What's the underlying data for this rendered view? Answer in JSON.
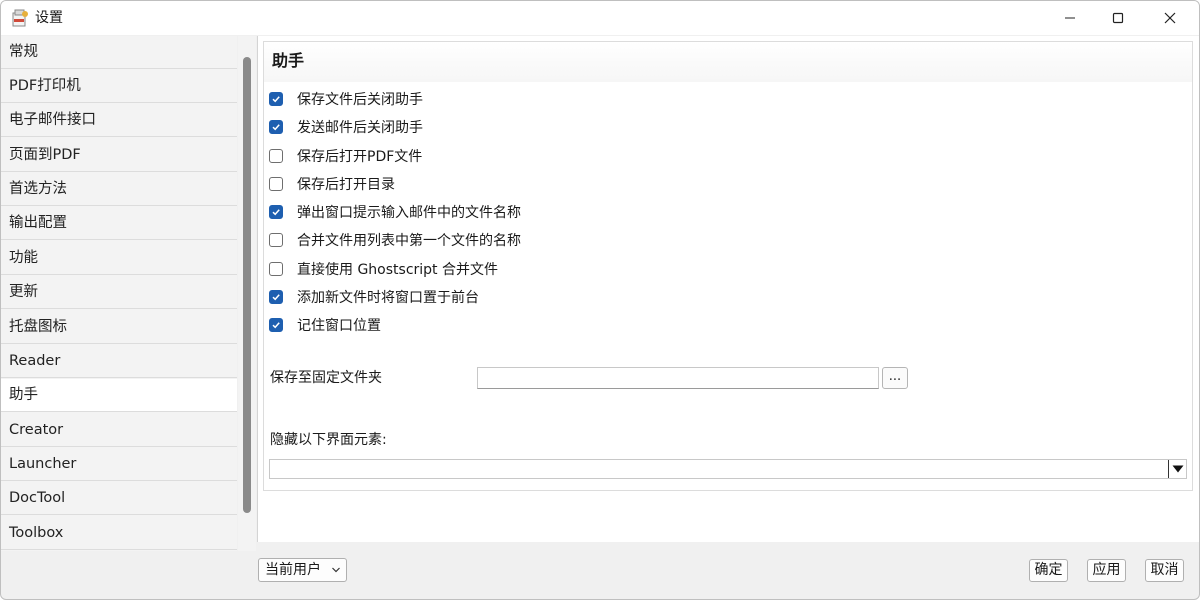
{
  "window": {
    "title": "设置"
  },
  "sidebar": {
    "items": [
      {
        "label": "常规"
      },
      {
        "label": "PDF打印机"
      },
      {
        "label": "电子邮件接口"
      },
      {
        "label": "页面到PDF"
      },
      {
        "label": "首选方法"
      },
      {
        "label": "输出配置"
      },
      {
        "label": "功能"
      },
      {
        "label": "更新"
      },
      {
        "label": "托盘图标"
      },
      {
        "label": "Reader"
      },
      {
        "label": "助手",
        "selected": true
      },
      {
        "label": "Creator"
      },
      {
        "label": "Launcher"
      },
      {
        "label": "DocTool"
      },
      {
        "label": "Toolbox"
      }
    ]
  },
  "panel": {
    "title": "助手",
    "options": [
      {
        "label": "保存文件后关闭助手",
        "checked": true
      },
      {
        "label": "发送邮件后关闭助手",
        "checked": true
      },
      {
        "label": "保存后打开PDF文件",
        "checked": false
      },
      {
        "label": "保存后打开目录",
        "checked": false
      },
      {
        "label": "弹出窗口提示输入邮件中的文件名称",
        "checked": true
      },
      {
        "label": "合并文件用列表中第一个文件的名称",
        "checked": false
      },
      {
        "label": "直接使用 Ghostscript 合并文件",
        "checked": false
      },
      {
        "label": "添加新文件时将窗口置于前台",
        "checked": true
      },
      {
        "label": "记住窗口位置",
        "checked": true
      }
    ],
    "folder_label": "保存至固定文件夹",
    "folder_value": "",
    "browse_label": "...",
    "hide_label": "隐藏以下界面元素:",
    "hide_value": ""
  },
  "footer": {
    "scope": "当前用户",
    "ok": "确定",
    "apply": "应用",
    "cancel": "取消"
  },
  "colors": {
    "accent": "#1e5fb0"
  }
}
